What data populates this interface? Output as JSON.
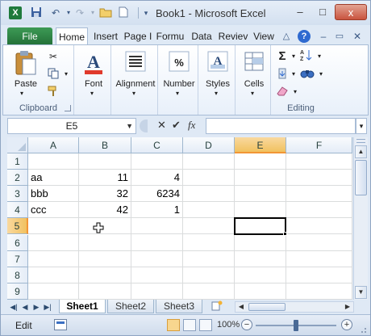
{
  "window": {
    "title": "Book1 - Microsoft Excel",
    "app_icon": "X",
    "controls": {
      "minimize": "–",
      "maximize": "□",
      "close": "x"
    }
  },
  "qat": {
    "icons": [
      "excel-app-icon",
      "save-icon",
      "undo-icon",
      "redo-icon",
      "open-folder-icon",
      "new-file-icon",
      "customize-qat-icon"
    ]
  },
  "tabs": [
    {
      "label": "File"
    },
    {
      "label": "Home",
      "active": true
    },
    {
      "label": "Insert"
    },
    {
      "label": "Page I"
    },
    {
      "label": "Formu"
    },
    {
      "label": "Data"
    },
    {
      "label": "Reviev"
    },
    {
      "label": "View"
    }
  ],
  "ribbon": {
    "groups": {
      "clipboard": {
        "label": "Clipboard",
        "paste": "Paste"
      },
      "font": {
        "label": "Font"
      },
      "alignment": {
        "label": "Alignment"
      },
      "number": {
        "label": "Number",
        "icon_text": "%"
      },
      "styles": {
        "label": "Styles",
        "icon_text": "A"
      },
      "cells": {
        "label": "Cells"
      },
      "editing": {
        "label": "Editing",
        "sum_icon": "Σ"
      }
    }
  },
  "formula_bar": {
    "name_box": "E5",
    "cancel": "✕",
    "enter": "✔",
    "fx": "fx",
    "formula": ""
  },
  "sheet": {
    "columns": [
      "A",
      "B",
      "C",
      "D",
      "E",
      "F"
    ],
    "rows": [
      "1",
      "2",
      "3",
      "4",
      "5",
      "6",
      "7",
      "8",
      "9"
    ],
    "cells": {
      "A2": "aa",
      "B2": "11",
      "C2": "4",
      "A3": "bbb",
      "B3": "32",
      "C3": "6234",
      "A4": "ccc",
      "B4": "42",
      "C4": "1"
    },
    "active_cell": "E5"
  },
  "sheet_tabs": {
    "tabs": [
      "Sheet1",
      "Sheet2",
      "Sheet3"
    ],
    "active": "Sheet1"
  },
  "status_bar": {
    "mode": "Edit",
    "zoom": "100%",
    "zoom_out": "−",
    "zoom_in": "+",
    "zoom_fraction": 0.5
  },
  "colors": {
    "file_tab": "#2a7c3f",
    "selected_header": "#f1c15f",
    "grid_line": "#dadcdd",
    "accent": "#2f6ad0"
  }
}
